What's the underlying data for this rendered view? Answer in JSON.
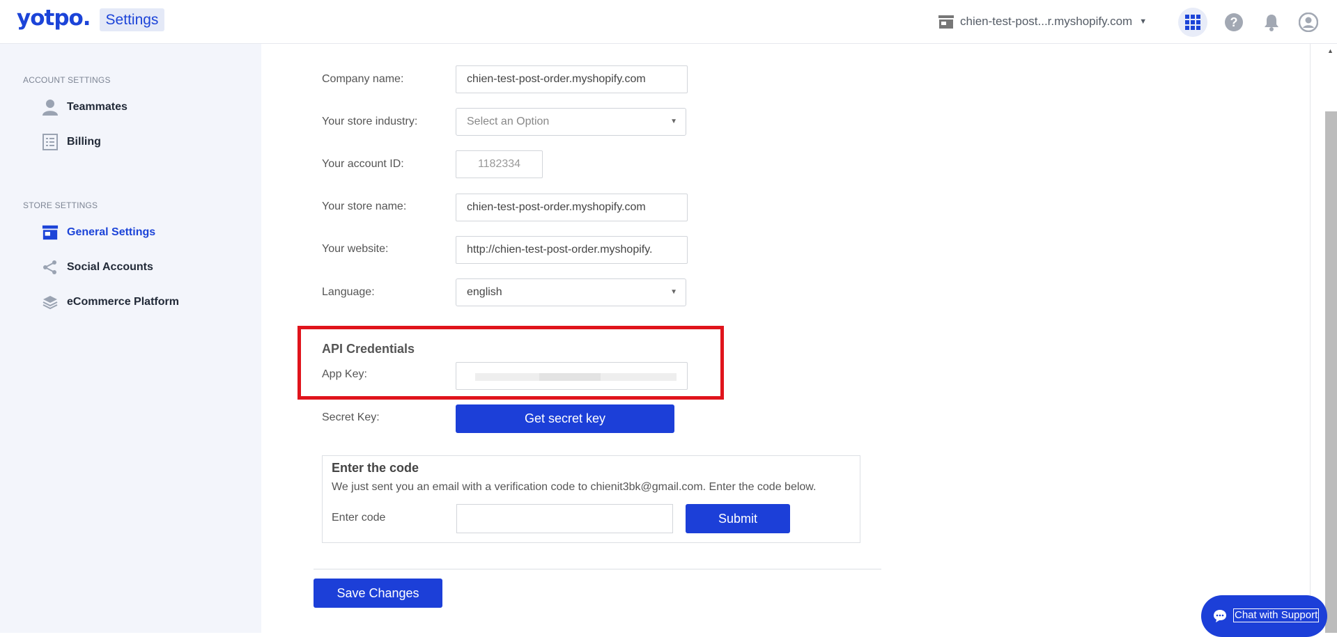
{
  "header": {
    "logo_text": "yotpo.",
    "app_name": "Settings",
    "store_name": "chien-test-post...r.myshopify.com",
    "icons": [
      "store-icon",
      "chevron-down-icon",
      "apps-grid-icon",
      "help-icon",
      "bell-icon",
      "user-icon"
    ]
  },
  "sidebar": {
    "account_label": "ACCOUNT SETTINGS",
    "account_items": [
      {
        "label": "Teammates",
        "icon": "person-icon"
      },
      {
        "label": "Billing",
        "icon": "list-icon"
      }
    ],
    "store_label": "STORE SETTINGS",
    "store_items": [
      {
        "label": "General Settings",
        "icon": "store-icon",
        "active": true
      },
      {
        "label": "Social Accounts",
        "icon": "share-icon"
      },
      {
        "label": "eCommerce Platform",
        "icon": "layers-icon"
      }
    ]
  },
  "form": {
    "company_name": {
      "label": "Company name:",
      "value": "chien-test-post-order.myshopify.com"
    },
    "store_industry": {
      "label": "Your store industry:",
      "value": "Select an Option"
    },
    "account_id": {
      "label": "Your account ID:",
      "value": "1182334"
    },
    "store_name": {
      "label": "Your store name:",
      "value": "chien-test-post-order.myshopify.com"
    },
    "website": {
      "label": "Your website:",
      "value": "http://chien-test-post-order.myshopify."
    },
    "language": {
      "label": "Language:",
      "value": "english"
    }
  },
  "api": {
    "title": "API Credentials",
    "app_key_label": "App Key:",
    "secret_key_label": "Secret Key:",
    "get_secret_button": "Get secret key"
  },
  "code": {
    "title": "Enter the code",
    "message": "We just sent you an email with a verification code to chienit3bk@gmail.com. Enter the code below.",
    "input_label": "Enter code",
    "submit_button": "Submit"
  },
  "save_button": "Save Changes",
  "chat_button": "Chat with Support",
  "colors": {
    "brand": "#1c44d8",
    "highlight": "#e0141c",
    "sidebar_bg": "#f3f5fb"
  }
}
